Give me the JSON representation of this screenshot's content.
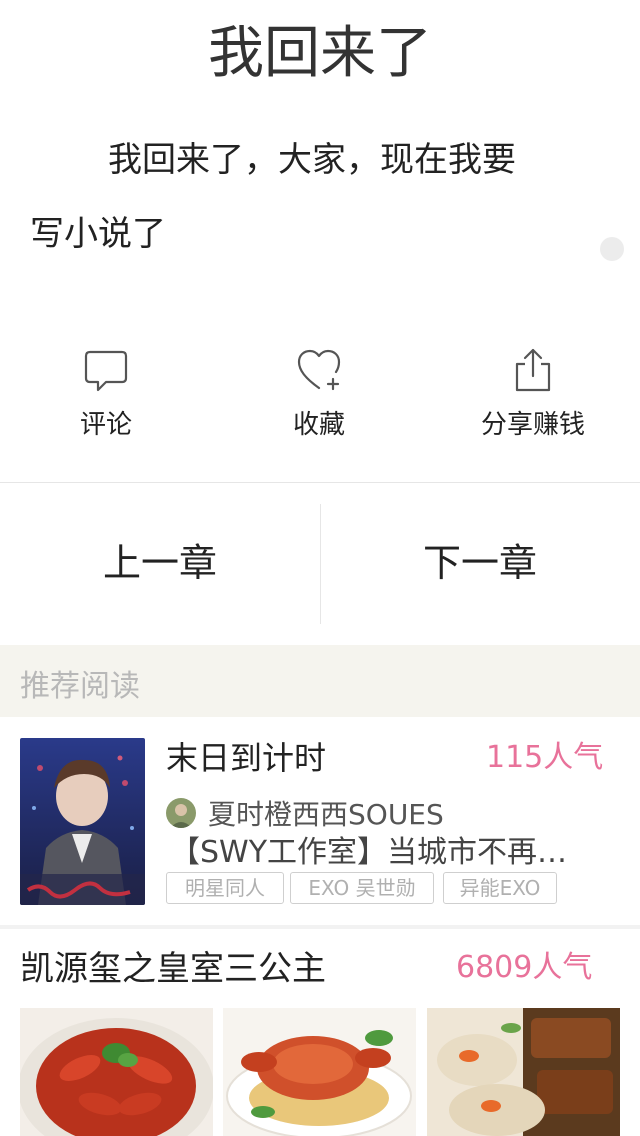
{
  "chapter": {
    "title": "我回来了",
    "paragraph_line1": "我回来了，大家，现在我要",
    "paragraph_line2": "写小说了"
  },
  "actions": [
    {
      "label": "评论",
      "icon": "comment-icon"
    },
    {
      "label": "收藏",
      "icon": "heart-plus-icon"
    },
    {
      "label": "分享赚钱",
      "icon": "share-icon"
    }
  ],
  "navigation": {
    "prev_label": "上一章",
    "next_label": "下一章"
  },
  "recommend": {
    "header": "推荐阅读",
    "book1": {
      "title": "末日到计时",
      "popularity": "115人气",
      "author": "夏时橙西西SOUES",
      "description": "【SWY工作室】当城市不再…",
      "tags": [
        "明星同人",
        "EXO 吴世勋",
        "异能EXO"
      ]
    },
    "book2": {
      "title": "凯源玺之皇室三公主",
      "popularity": "6809人气"
    }
  },
  "colors": {
    "accent_pink": "#e8729a",
    "header_bg": "#f5f4ee",
    "tag_border": "#cfcfcf"
  }
}
